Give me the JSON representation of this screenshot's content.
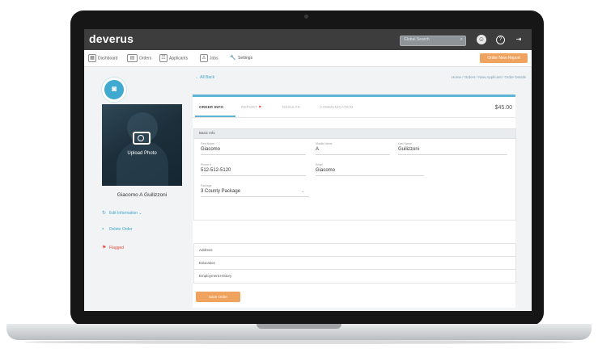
{
  "app": {
    "logo": "deverus"
  },
  "header": {
    "search_placeholder": "Global Search",
    "icons": [
      "user-avatar-icon",
      "help-icon",
      "logout-icon"
    ]
  },
  "nav": {
    "items": [
      {
        "label": "Dashboard",
        "icon": "dashboard-icon"
      },
      {
        "label": "Orders",
        "icon": "orders-icon"
      },
      {
        "label": "Applicants",
        "icon": "applicants-icon"
      },
      {
        "label": "Jobs",
        "icon": "jobs-icon"
      },
      {
        "label": "Settings",
        "icon": "wrench-icon"
      }
    ],
    "cta_label": "Order New Report"
  },
  "subbar": {
    "back_label": "← All Back",
    "breadcrumb": "Home / Orders / New Applicant / Order Details"
  },
  "sidebar": {
    "upload_label": "Upload Photo",
    "person_name": "Giacomo A Guilizzoni",
    "actions": [
      {
        "label": "Edit Information ⌄",
        "icon": "refresh-icon",
        "color": "#3ca6cc"
      },
      {
        "label": "Delete Order",
        "icon": "trash-icon",
        "color": "#3ca6cc"
      },
      {
        "label": "Flagged",
        "icon": "flag-icon",
        "color": "#e04a3f"
      }
    ]
  },
  "main": {
    "tabs": [
      "ORDER INFO",
      "REPORT",
      "RESULTS",
      "COMMUNICATION"
    ],
    "price": "$45.00",
    "section_title": "Basic Info",
    "fields": {
      "first_name": {
        "label": "First Name",
        "value": "Giacomo"
      },
      "middle_name": {
        "label": "Middle Name",
        "value": "A"
      },
      "last_name": {
        "label": "Last Name",
        "value": "Guilizzoni"
      },
      "phone": {
        "label": "Phone #",
        "value": "512-512-5120"
      },
      "email": {
        "label": "Email",
        "value": "Giacomo"
      },
      "package": {
        "label": "Package",
        "value": "3 County Package"
      }
    },
    "rows": [
      "Address",
      "Education",
      "Employment History"
    ],
    "save_label": "Save Order"
  },
  "colors": {
    "accent": "#3fa9cf",
    "orange": "#f0a35e",
    "topbar": "#3d3d3d",
    "flag": "#e04a3f"
  }
}
